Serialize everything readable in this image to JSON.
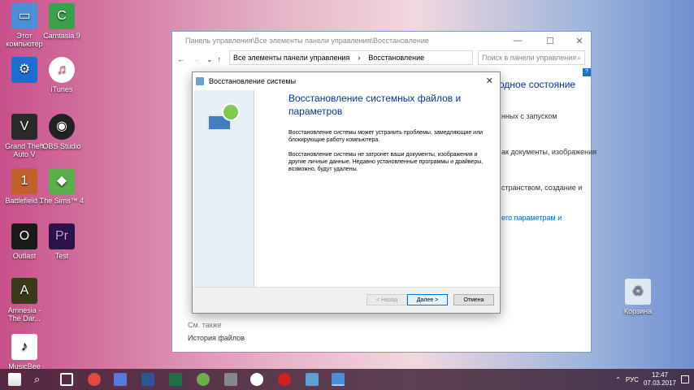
{
  "desktop": {
    "icons": [
      {
        "label": "Этот\nкомпьютер",
        "icon": "computer-icon",
        "color": "#4a8fd8"
      },
      {
        "label": "Camtasia 9",
        "icon": "camtasia-icon",
        "color": "#3aa04a"
      },
      {
        "label": "",
        "icon": "settings-icon",
        "color": "#1c6fd0"
      },
      {
        "label": "iTunes",
        "icon": "itunes-icon",
        "color": "#ffffff"
      },
      {
        "label": "Grand Theft\nAuto V",
        "icon": "gta-icon",
        "color": "#2a2a2a"
      },
      {
        "label": "OBS Studio",
        "icon": "obs-icon",
        "color": "#222222"
      },
      {
        "label": "Battlefield 1",
        "icon": "battlefield-icon",
        "color": "#c0602a"
      },
      {
        "label": "The Sims™ 4",
        "icon": "sims-icon",
        "color": "#59b04a"
      },
      {
        "label": "Outlast",
        "icon": "outlast-icon",
        "color": "#1a1a1a"
      },
      {
        "label": "Test",
        "icon": "premiere-icon",
        "color": "#2a1448"
      },
      {
        "label": "Amnesia -\nThe Dar...",
        "icon": "amnesia-icon",
        "color": "#3a3a1a"
      },
      {
        "label": "MusicBee",
        "icon": "musicbee-icon",
        "color": "#ffffff"
      },
      {
        "label": "Корзина",
        "icon": "recycle-bin-icon",
        "color": "#dfe9f3"
      }
    ]
  },
  "control_panel": {
    "title": "Панель управления\\Все элементы панели управления\\Восстановление",
    "address_parts": [
      "Все элементы панели управления",
      "Восстановление"
    ],
    "search_placeholder": "Поиск в панели управления",
    "heading_fragment": "одное состояние",
    "fragments": [
      "нных с запуском",
      "ак документы, изображения",
      "странством, создание и",
      "его параметрам и"
    ],
    "see_also": "См. также",
    "file_history": "История файлов"
  },
  "dialog": {
    "title": "Восстановление системы",
    "heading": "Восстановление системных файлов и параметров",
    "para1": "Восстановление системы может устранить проблемы, замедляющие или блокирующие работу компьютера.",
    "para2": "Восстановление системы не затронет ваши документы, изображения и другие личные данные. Недавно установленные программы и драйверы, возможно, будут удалены.",
    "back_label": "< Назад",
    "next_label": "Далее >",
    "cancel_label": "Отмена"
  },
  "taskbar": {
    "language": "РУС",
    "time": "12:47",
    "date": "07.03.2017"
  }
}
